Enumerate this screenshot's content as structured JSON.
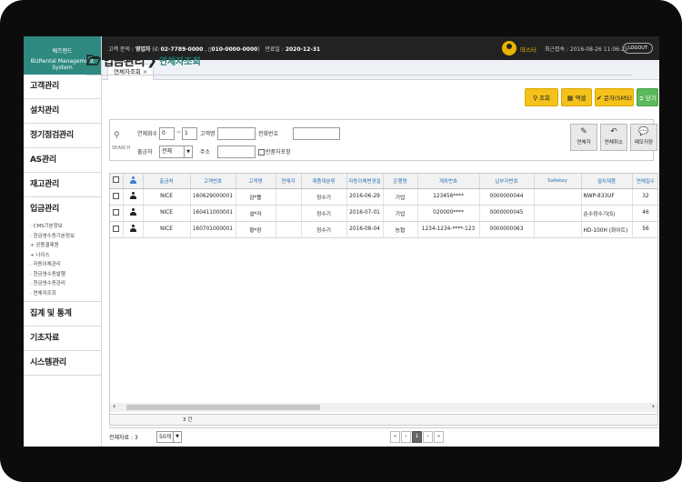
{
  "app": {
    "company": "베즈렌드",
    "subtitle": "BizRental Management System"
  },
  "header": {
    "contact_label": "고객 문의 :",
    "sales_label": "영업자",
    "phone1": "02-7789-0000",
    "phone2": "010-0000-0000",
    "expiry_label": "만료일 :",
    "expiry_date": "2020-12-31",
    "user_name": "마스터",
    "last_login": "최근접속 : 2016-08-26 11:06:25",
    "logout": "LOGOUT"
  },
  "sidebar": {
    "items": [
      {
        "label": "고객관리"
      },
      {
        "label": "설치관리"
      },
      {
        "label": "정기점검관리"
      },
      {
        "label": "AS관리"
      },
      {
        "label": "재고관리"
      },
      {
        "label": "입금관리"
      },
      {
        "label": "집계 및 통계"
      },
      {
        "label": "기초자료"
      },
      {
        "label": "시스템관리"
      }
    ],
    "sub_items": [
      "· CMS기본정보",
      "· 현금영수증기본정보",
      "+ 공용결제원",
      "+ 나이스",
      "· 자동이체관리",
      "· 현금영수증발행",
      "· 현금영수증관리",
      "· 연체자조회"
    ]
  },
  "tabs": [
    {
      "label": "연체자조회",
      "close": "×"
    }
  ],
  "page": {
    "title": "입금관리",
    "subtitle": "연체자조회"
  },
  "toolbar": {
    "search": "조회",
    "excel": "엑셀",
    "sms": "문자(SMS)",
    "close": "닫기"
  },
  "search": {
    "icon_label": "SEARCH",
    "overdue_label": "연체회수",
    "overdue_from": "0",
    "range_sep": "~",
    "overdue_to": "1",
    "customer_label": "고객명",
    "customer_value": "",
    "phone_label": "전화번호",
    "phone_value": "",
    "channel_label": "출금처",
    "channel_value": "전체",
    "address_label": "주소",
    "address_value": "",
    "include_returns": "반품자포함"
  },
  "actions": {
    "overdue": "연체자",
    "cancel_overdue": "연체취소",
    "memo": "메모저장"
  },
  "table": {
    "columns": [
      "출금처",
      "고객번호",
      "고객명",
      "연체자",
      "제품대분류",
      "자동이체변경일",
      "은행명",
      "계좌번호",
      "납부자번호",
      "Safekey",
      "설치제품",
      "연체일수"
    ],
    "rows": [
      [
        "NICE",
        "160629000001",
        "감*틀",
        "",
        "정수기",
        "2016-06-29",
        "기업",
        "123456****",
        "0000000044",
        "",
        "NWP-833UF",
        "32"
      ],
      [
        "NICE",
        "160411000001",
        "설*자",
        "",
        "정수기",
        "2016-07-01",
        "기업",
        "020000****",
        "0000000045",
        "",
        "순수정수기(S)",
        "46"
      ],
      [
        "NICE",
        "160701000001",
        "황*장",
        "",
        "정수기",
        "2016-08-04",
        "농협",
        "1234-1234-****-123",
        "0000000063",
        "",
        "HD-100H (화이트)",
        "56"
      ]
    ],
    "count": "3 건"
  },
  "footer": {
    "total": "전체자료 : 3",
    "page_size": "50개",
    "pager": [
      "«",
      "‹",
      "1",
      "›",
      "»"
    ]
  },
  "colors": {
    "brand": "#2e8a80",
    "accent_yellow": "#f4c21a",
    "accent_green": "#5cb85c",
    "header_bg": "#222222"
  }
}
